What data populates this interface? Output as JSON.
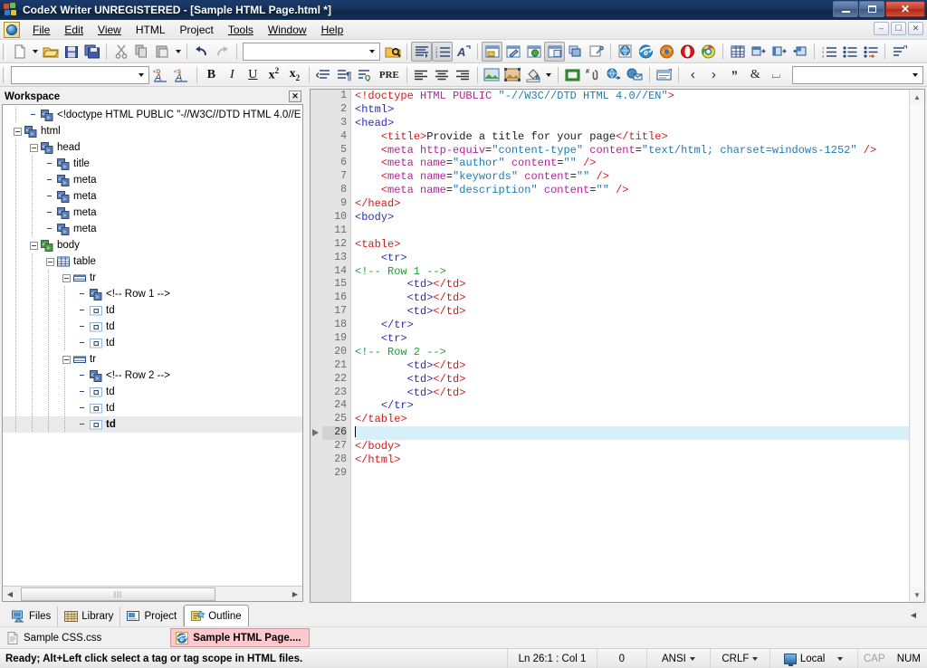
{
  "window": {
    "title": "CodeX Writer UNREGISTERED - [Sample HTML Page.html *]",
    "minimize_label": "Minimize",
    "maximize_label": "Maximize",
    "close_label": "✕"
  },
  "mdi_buttons": {
    "minimize": "–",
    "restore": "❐",
    "close": "✕"
  },
  "menu": {
    "items": [
      {
        "label": "File"
      },
      {
        "label": "Edit"
      },
      {
        "label": "View"
      },
      {
        "label": "HTML"
      },
      {
        "label": "Project"
      },
      {
        "label": "Tools"
      },
      {
        "label": "Window"
      },
      {
        "label": "Help"
      }
    ]
  },
  "toolbar1": {
    "combo_value": "",
    "items": [
      "new-file-icon",
      "new-file-dropdown",
      "open-folder-icon",
      "save-icon",
      "save-all-icon",
      "cut-icon",
      "copy-icon",
      "paste-icon",
      "paste-dropdown",
      "undo-icon",
      "redo-icon",
      "find-combo",
      "find-in-files-icon",
      "word-wrap-icon",
      "line-numbers-icon",
      "special-chars-icon",
      "preview-window-icon",
      "preview-edit-icon",
      "preview-browser-icon",
      "preview-split-icon",
      "windows-cascade-icon",
      "properties-icon",
      "browse-globe-icon",
      "internet-explorer-icon",
      "firefox-icon",
      "opera-icon",
      "chrome-icon",
      "insert-table-icon",
      "insert-row-icon",
      "insert-column-icon",
      "insert-cell-icon",
      "ordered-list-icon",
      "unordered-list-icon",
      "definition-list-icon",
      "list-options-icon"
    ]
  },
  "toolbar2": {
    "style_combo_value": "",
    "right_combo_value": "",
    "items": [
      "style-combo",
      "doctype-icon",
      "style-tag-icon",
      "bold-icon",
      "italic-icon",
      "underline-icon",
      "superscript-icon",
      "subscript-icon",
      "indent-icon",
      "paragraph-icon",
      "blockquote-icon",
      "pre-icon",
      "align-left-icon",
      "align-center-icon",
      "align-right-icon",
      "insert-image-icon",
      "image-map-icon",
      "background-color-icon",
      "background-dropdown",
      "insert-form-icon",
      "anchor-icon",
      "hyperlink-icon",
      "email-link-icon",
      "frame-icon",
      "prev-tag-icon",
      "next-tag-icon",
      "quote-entity-icon",
      "ampersand-entity-icon",
      "nbsp-entity-icon",
      "entity-combo"
    ],
    "bold": "B",
    "italic": "I",
    "underline": "U",
    "superscript": "x",
    "superscript_sup": "2",
    "subscript": "x",
    "subscript_sub": "2",
    "pre": "PRE",
    "prev_tag": "‹",
    "next_tag": "›",
    "quote_entity": "”",
    "amp_entity": "&",
    "nbsp_entity": "⌴"
  },
  "workspace": {
    "title": "Workspace",
    "close_label": "✕",
    "tree": [
      {
        "indent": 1,
        "expander": "none",
        "icon": "tag-icon",
        "label": "<!doctype HTML PUBLIC \"-//W3C//DTD HTML 4.0//E",
        "selected": false,
        "bold": false
      },
      {
        "indent": 0,
        "expander": "minus",
        "icon": "tag-icon",
        "label": "html",
        "selected": false,
        "bold": false
      },
      {
        "indent": 1,
        "expander": "minus",
        "icon": "tag-icon",
        "label": "head",
        "selected": false,
        "bold": false
      },
      {
        "indent": 2,
        "expander": "none",
        "icon": "tag-icon",
        "label": "title",
        "selected": false,
        "bold": false
      },
      {
        "indent": 2,
        "expander": "none",
        "icon": "tag-icon",
        "label": "meta",
        "selected": false,
        "bold": false
      },
      {
        "indent": 2,
        "expander": "none",
        "icon": "tag-icon",
        "label": "meta",
        "selected": false,
        "bold": false
      },
      {
        "indent": 2,
        "expander": "none",
        "icon": "tag-icon",
        "label": "meta",
        "selected": false,
        "bold": false
      },
      {
        "indent": 2,
        "expander": "none",
        "icon": "tag-icon",
        "label": "meta",
        "selected": false,
        "bold": false
      },
      {
        "indent": 1,
        "expander": "minus",
        "icon": "tag-green-icon",
        "label": "body",
        "selected": false,
        "bold": false
      },
      {
        "indent": 2,
        "expander": "minus",
        "icon": "table-icon",
        "label": "table",
        "selected": false,
        "bold": false
      },
      {
        "indent": 3,
        "expander": "minus",
        "icon": "row-icon",
        "label": "tr",
        "selected": false,
        "bold": false
      },
      {
        "indent": 4,
        "expander": "none",
        "icon": "tag-icon",
        "label": "<!-- Row 1 -->",
        "selected": false,
        "bold": false
      },
      {
        "indent": 4,
        "expander": "none",
        "icon": "cell-icon",
        "label": "td",
        "selected": false,
        "bold": false
      },
      {
        "indent": 4,
        "expander": "none",
        "icon": "cell-icon",
        "label": "td",
        "selected": false,
        "bold": false
      },
      {
        "indent": 4,
        "expander": "none",
        "icon": "cell-icon",
        "label": "td",
        "selected": false,
        "bold": false
      },
      {
        "indent": 3,
        "expander": "minus",
        "icon": "row-icon",
        "label": "tr",
        "selected": false,
        "bold": false
      },
      {
        "indent": 4,
        "expander": "none",
        "icon": "tag-icon",
        "label": "<!-- Row 2 -->",
        "selected": false,
        "bold": false
      },
      {
        "indent": 4,
        "expander": "none",
        "icon": "cell-icon",
        "label": "td",
        "selected": false,
        "bold": false
      },
      {
        "indent": 4,
        "expander": "none",
        "icon": "cell-icon",
        "label": "td",
        "selected": false,
        "bold": false
      },
      {
        "indent": 4,
        "expander": "none",
        "icon": "cell-icon",
        "label": "td",
        "selected": true,
        "bold": true
      }
    ]
  },
  "dock_tabs": [
    {
      "label": "Files",
      "icon": "files-icon",
      "active": false
    },
    {
      "label": "Library",
      "icon": "library-icon",
      "active": false
    },
    {
      "label": "Project",
      "icon": "project-icon",
      "active": false
    },
    {
      "label": "Outline",
      "icon": "outline-icon",
      "active": true
    }
  ],
  "editor": {
    "current_line": 26,
    "lines": [
      {
        "n": 1,
        "tokens": [
          {
            "t": "tag",
            "v": "<!doctype"
          },
          {
            "t": "txt",
            "v": " "
          },
          {
            "t": "attr",
            "v": "HTML PUBLIC"
          },
          {
            "t": "txt",
            "v": " "
          },
          {
            "t": "val",
            "v": "\"-//W3C//DTD HTML 4.0//EN\""
          },
          {
            "t": "tag",
            "v": ">"
          }
        ]
      },
      {
        "n": 2,
        "tokens": [
          {
            "t": "tag2",
            "v": "<html>"
          }
        ]
      },
      {
        "n": 3,
        "tokens": [
          {
            "t": "tag2",
            "v": "<head>"
          }
        ]
      },
      {
        "n": 4,
        "tokens": [
          {
            "t": "txt",
            "v": "    "
          },
          {
            "t": "tag",
            "v": "<title>"
          },
          {
            "t": "txt",
            "v": "Provide a title for your page"
          },
          {
            "t": "tag",
            "v": "</title>"
          }
        ]
      },
      {
        "n": 5,
        "tokens": [
          {
            "t": "txt",
            "v": "    "
          },
          {
            "t": "tag",
            "v": "<"
          },
          {
            "t": "attr",
            "v": "meta"
          },
          {
            "t": "txt",
            "v": " "
          },
          {
            "t": "tk2",
            "v": "http-equiv"
          },
          {
            "t": "txt",
            "v": "="
          },
          {
            "t": "val",
            "v": "\"content-type\""
          },
          {
            "t": "txt",
            "v": " "
          },
          {
            "t": "tk2",
            "v": "content"
          },
          {
            "t": "txt",
            "v": "="
          },
          {
            "t": "val",
            "v": "\"text/html; charset=windows-1252\""
          },
          {
            "t": "txt",
            "v": " "
          },
          {
            "t": "tag",
            "v": "/>"
          }
        ]
      },
      {
        "n": 6,
        "tokens": [
          {
            "t": "txt",
            "v": "    "
          },
          {
            "t": "tag",
            "v": "<"
          },
          {
            "t": "attr",
            "v": "meta"
          },
          {
            "t": "txt",
            "v": " "
          },
          {
            "t": "tk2",
            "v": "name"
          },
          {
            "t": "txt",
            "v": "="
          },
          {
            "t": "val",
            "v": "\"author\""
          },
          {
            "t": "txt",
            "v": " "
          },
          {
            "t": "tk2",
            "v": "content"
          },
          {
            "t": "txt",
            "v": "="
          },
          {
            "t": "val",
            "v": "\"\""
          },
          {
            "t": "txt",
            "v": " "
          },
          {
            "t": "tag",
            "v": "/>"
          }
        ]
      },
      {
        "n": 7,
        "tokens": [
          {
            "t": "txt",
            "v": "    "
          },
          {
            "t": "tag",
            "v": "<"
          },
          {
            "t": "attr",
            "v": "meta"
          },
          {
            "t": "txt",
            "v": " "
          },
          {
            "t": "tk2",
            "v": "name"
          },
          {
            "t": "txt",
            "v": "="
          },
          {
            "t": "val",
            "v": "\"keywords\""
          },
          {
            "t": "txt",
            "v": " "
          },
          {
            "t": "tk2",
            "v": "content"
          },
          {
            "t": "txt",
            "v": "="
          },
          {
            "t": "val",
            "v": "\"\""
          },
          {
            "t": "txt",
            "v": " "
          },
          {
            "t": "tag",
            "v": "/>"
          }
        ]
      },
      {
        "n": 8,
        "tokens": [
          {
            "t": "txt",
            "v": "    "
          },
          {
            "t": "tag",
            "v": "<"
          },
          {
            "t": "attr",
            "v": "meta"
          },
          {
            "t": "txt",
            "v": " "
          },
          {
            "t": "tk2",
            "v": "name"
          },
          {
            "t": "txt",
            "v": "="
          },
          {
            "t": "val",
            "v": "\"description\""
          },
          {
            "t": "txt",
            "v": " "
          },
          {
            "t": "tk2",
            "v": "content"
          },
          {
            "t": "txt",
            "v": "="
          },
          {
            "t": "val",
            "v": "\"\""
          },
          {
            "t": "txt",
            "v": " "
          },
          {
            "t": "tag",
            "v": "/>"
          }
        ]
      },
      {
        "n": 9,
        "tokens": [
          {
            "t": "tag",
            "v": "</head>"
          }
        ]
      },
      {
        "n": 10,
        "tokens": [
          {
            "t": "tag2",
            "v": "<body>"
          }
        ]
      },
      {
        "n": 11,
        "tokens": []
      },
      {
        "n": 12,
        "tokens": [
          {
            "t": "tag",
            "v": "<table>"
          }
        ]
      },
      {
        "n": 13,
        "tokens": [
          {
            "t": "txt",
            "v": "    "
          },
          {
            "t": "tag2",
            "v": "<tr>"
          }
        ]
      },
      {
        "n": 14,
        "tokens": [
          {
            "t": "com",
            "v": "<!-- Row 1 -->"
          }
        ]
      },
      {
        "n": 15,
        "tokens": [
          {
            "t": "txt",
            "v": "        "
          },
          {
            "t": "tag2",
            "v": "<td>"
          },
          {
            "t": "tag",
            "v": "</td>"
          }
        ]
      },
      {
        "n": 16,
        "tokens": [
          {
            "t": "txt",
            "v": "        "
          },
          {
            "t": "tag2",
            "v": "<td>"
          },
          {
            "t": "tag",
            "v": "</td>"
          }
        ]
      },
      {
        "n": 17,
        "tokens": [
          {
            "t": "txt",
            "v": "        "
          },
          {
            "t": "tag2",
            "v": "<td>"
          },
          {
            "t": "tag",
            "v": "</td>"
          }
        ]
      },
      {
        "n": 18,
        "tokens": [
          {
            "t": "txt",
            "v": "    "
          },
          {
            "t": "tag2",
            "v": "</tr>"
          }
        ]
      },
      {
        "n": 19,
        "tokens": [
          {
            "t": "txt",
            "v": "    "
          },
          {
            "t": "tag2",
            "v": "<tr>"
          }
        ]
      },
      {
        "n": 20,
        "tokens": [
          {
            "t": "com",
            "v": "<!-- Row 2 -->"
          }
        ]
      },
      {
        "n": 21,
        "tokens": [
          {
            "t": "txt",
            "v": "        "
          },
          {
            "t": "tag2",
            "v": "<td>"
          },
          {
            "t": "tag",
            "v": "</td>"
          }
        ]
      },
      {
        "n": 22,
        "tokens": [
          {
            "t": "txt",
            "v": "        "
          },
          {
            "t": "tag2",
            "v": "<td>"
          },
          {
            "t": "tag",
            "v": "</td>"
          }
        ]
      },
      {
        "n": 23,
        "tokens": [
          {
            "t": "txt",
            "v": "        "
          },
          {
            "t": "tag2",
            "v": "<td>"
          },
          {
            "t": "tag",
            "v": "</td>"
          }
        ]
      },
      {
        "n": 24,
        "tokens": [
          {
            "t": "txt",
            "v": "    "
          },
          {
            "t": "tag2",
            "v": "</tr>"
          }
        ]
      },
      {
        "n": 25,
        "tokens": [
          {
            "t": "tag",
            "v": "</table>"
          }
        ]
      },
      {
        "n": 26,
        "tokens": [],
        "caret": true
      },
      {
        "n": 27,
        "tokens": [
          {
            "t": "tag",
            "v": "</body>"
          }
        ]
      },
      {
        "n": 28,
        "tokens": [
          {
            "t": "tag",
            "v": "</html>"
          }
        ]
      },
      {
        "n": 29,
        "tokens": []
      }
    ]
  },
  "file_tabs": [
    {
      "label": "Sample CSS.css",
      "icon": "css-file-icon",
      "active": false
    },
    {
      "label": "Sample HTML Page....",
      "icon": "html-file-icon",
      "active": true
    }
  ],
  "statusbar": {
    "message": "Ready; Alt+Left click select a tag or tag scope in HTML files.",
    "position": "Ln 26:1 : Col 1",
    "selection_count": "0",
    "encoding": "ANSI",
    "line_ending": "CRLF",
    "location": "Local",
    "caps": "CAP",
    "num": "NUM"
  },
  "colors": {
    "titlebar_start": "#1b3b6b",
    "titlebar_end": "#14305a",
    "close_button": "#c33c28",
    "active_tab_bg": "#ffc8cf",
    "current_line": "#d6f0fa",
    "syntax_tag": "#d41919",
    "syntax_tag_alt": "#2b2bb5",
    "syntax_attr": "#b8219c",
    "syntax_value": "#1f7ab5",
    "syntax_comment": "#1e9c32"
  }
}
